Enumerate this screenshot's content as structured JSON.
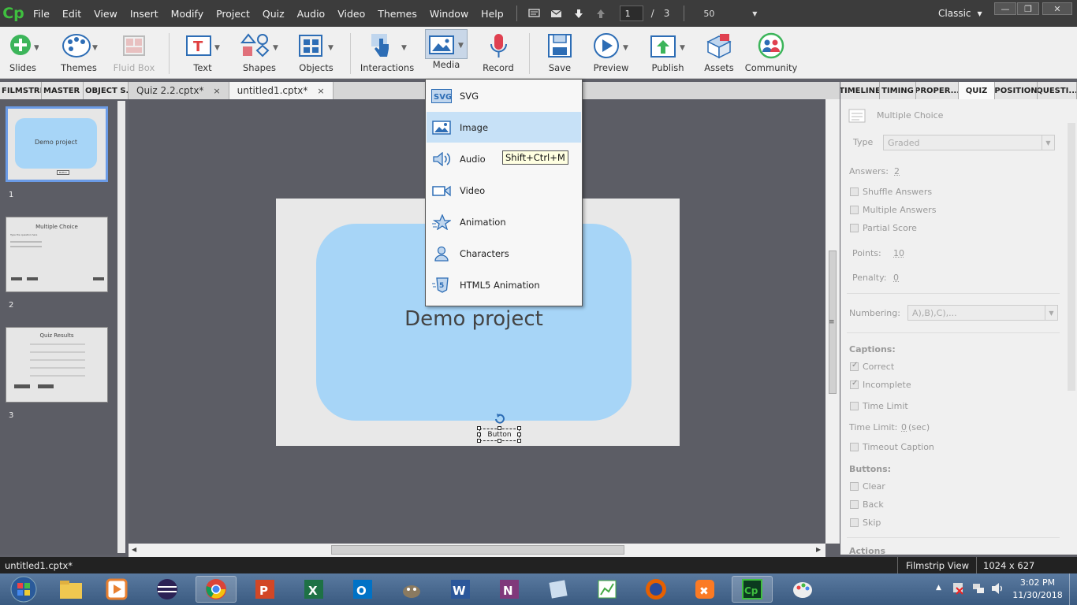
{
  "menubar": {
    "logo": "Cp",
    "items": [
      "File",
      "Edit",
      "View",
      "Insert",
      "Modify",
      "Project",
      "Quiz",
      "Audio",
      "Video",
      "Themes",
      "Window",
      "Help"
    ],
    "page_current": "1",
    "page_sep": "/",
    "page_total": "3",
    "zoom": "50",
    "workspace": "Classic"
  },
  "toolbar": {
    "slides": "Slides",
    "themes": "Themes",
    "fluid_box": "Fluid Box",
    "text": "Text",
    "shapes": "Shapes",
    "objects": "Objects",
    "interactions": "Interactions",
    "media": "Media",
    "record": "Record",
    "save": "Save",
    "preview": "Preview",
    "publish": "Publish",
    "assets": "Assets",
    "community": "Community"
  },
  "left_tabs": [
    "FILMSTRIP",
    "MASTER ...",
    "OBJECT S..."
  ],
  "doc_tabs": [
    {
      "label": "Quiz 2.2.cptx*",
      "close": "×"
    },
    {
      "label": "untitled1.cptx*",
      "close": "×"
    }
  ],
  "right_tabs": [
    "TIMELINE",
    "TIMING",
    "PROPER...",
    "QUIZ",
    "POSITION",
    "QUESTI..."
  ],
  "filmstrip": {
    "slides": [
      {
        "num": "1",
        "title": "Demo project",
        "button": "Button"
      },
      {
        "num": "2",
        "title": "Multiple Choice",
        "body": "Type the question here"
      },
      {
        "num": "3",
        "title": "Quiz Results"
      }
    ]
  },
  "slide": {
    "title": "Demo project",
    "button": "Button"
  },
  "media_menu": {
    "items": [
      {
        "label": "SVG",
        "icon": "svg-icon"
      },
      {
        "label": "Image",
        "icon": "image-icon"
      },
      {
        "label": "Audio",
        "icon": "audio-icon"
      },
      {
        "label": "Video",
        "icon": "video-icon"
      },
      {
        "label": "Animation",
        "icon": "animation-icon"
      },
      {
        "label": "Characters",
        "icon": "characters-icon"
      },
      {
        "label": "HTML5 Animation",
        "icon": "html5-icon"
      }
    ],
    "highlighted": "Image",
    "tooltip": "Shift+Ctrl+M"
  },
  "props": {
    "header": "Multiple Choice",
    "type_label": "Type",
    "type_value": "Graded",
    "answers_label": "Answers:",
    "answers_value": "2",
    "shuffle": "Shuffle Answers",
    "multiple": "Multiple Answers",
    "partial": "Partial Score",
    "points_label": "Points:",
    "points_value": "10",
    "penalty_label": "Penalty:",
    "penalty_value": "0",
    "numbering_label": "Numbering:",
    "numbering_value": "A),B),C),...",
    "captions_label": "Captions:",
    "correct": "Correct",
    "incomplete": "Incomplete",
    "time_limit": "Time Limit",
    "time_limit_label": "Time Limit:",
    "time_limit_value": "0",
    "time_unit": "(sec)",
    "timeout_caption": "Timeout Caption",
    "buttons_label": "Buttons:",
    "clear": "Clear",
    "back": "Back",
    "skip": "Skip",
    "actions_label": "Actions"
  },
  "statusbar": {
    "file": "untitled1.cptx*",
    "view": "Filmstrip View",
    "size": "1024 x 627"
  },
  "taskbar": {
    "time": "3:02 PM",
    "date": "11/30/2018"
  }
}
